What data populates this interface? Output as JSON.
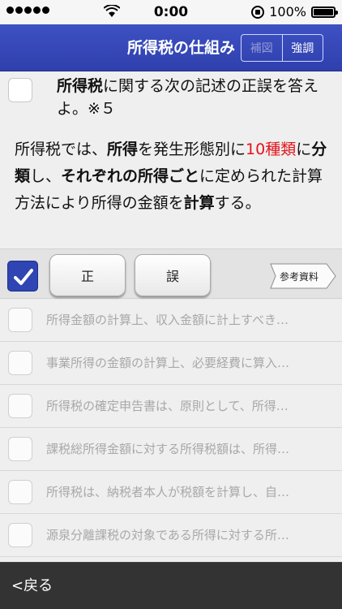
{
  "status_bar": {
    "time": "0:00",
    "battery": "100%"
  },
  "nav": {
    "title": "所得税の仕組み",
    "hint_label": "補図",
    "emphasis_label": "強調"
  },
  "question": {
    "head_bold": "所得税",
    "head_rest": "に関する次の記述の正誤を答えよ。※５",
    "body": {
      "p1": "所得税では、",
      "b1": "所得",
      "p2": "を発生形態別に",
      "r1": "10種類",
      "p3": "に",
      "b2": "分類",
      "p4": "し、",
      "b3": "それぞれの所得ごと",
      "p5": "に定められた計算方法により所得の金額を",
      "b4": "計算",
      "p6": "する。"
    }
  },
  "answer": {
    "true_label": "正",
    "false_label": "誤",
    "reference_label": "参考資料"
  },
  "list": [
    "所得金額の計算上、収入金額に計上すべき…",
    "事業所得の金額の計算上、必要経費に算入…",
    "所得税の確定申告書は、原則として、所得…",
    "課税総所得金額に対する所得税額は、所得…",
    "所得税は、納税者本人が税額を計算し、自…",
    "源泉分離課税の対象である所得に対する所…"
  ],
  "footer": {
    "back_label": "<戻る"
  },
  "colors": {
    "nav_blue": "#3446b8",
    "highlight_red": "#e3141c",
    "checked_blue": "#2f45b3"
  }
}
